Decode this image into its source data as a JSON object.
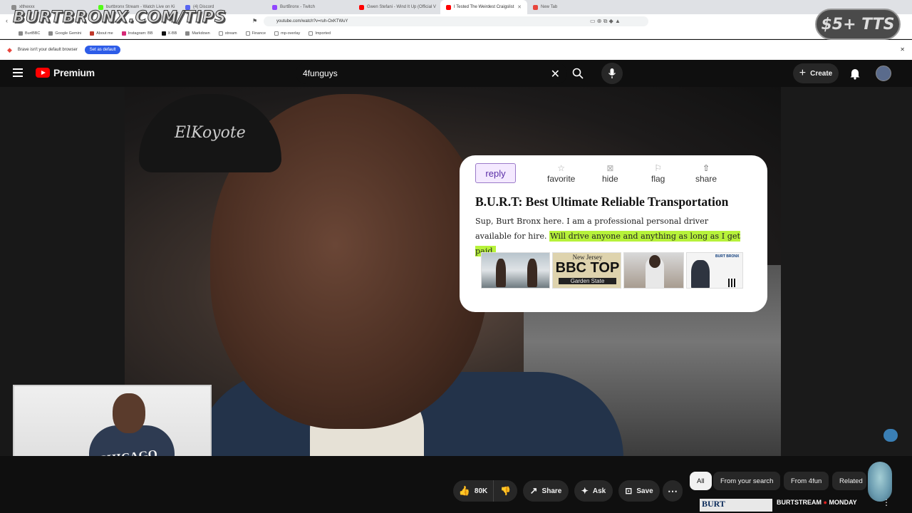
{
  "browser": {
    "tabs": [
      {
        "title": "xlthexxx",
        "fav_color": "#8c8c8c"
      },
      {
        "title": "burtbronx Stream - Watch Live on Ki",
        "fav_color": "#53fc18"
      },
      {
        "title": "(4) Discord",
        "fav_color": "#5865f2"
      },
      {
        "title": "BurtBronx - Twitch",
        "fav_color": "#9146ff"
      },
      {
        "title": "Gwen Stefani - Wind It Up (Official V",
        "fav_color": "#ff0000"
      },
      {
        "title": "I Tested The Weirdest Craigslist",
        "fav_color": "#ff0000",
        "active": true
      },
      {
        "title": "New Tab",
        "fav_color": "#e8453c"
      }
    ],
    "url": "youtube.com/watch?v=ruh-OxKTWuY",
    "bookmarks": [
      "BurtBBC",
      "Google Gemini",
      "About me",
      "Instagram: BB",
      "X-BB",
      "Markdown",
      "stream",
      "Finance",
      "mp-overlay",
      "Imported"
    ],
    "infobar_text": "Brave isn't your default browser",
    "infobar_button": "Set as default"
  },
  "overlay": {
    "brand": "BURTBRONX.COM/TIPS",
    "tts": "$5+ TTS"
  },
  "youtube": {
    "logo_text": "Premium",
    "search_value": "4funguys",
    "create_label": "Create"
  },
  "video": {
    "cap_text": "ElKoyote",
    "card": {
      "reply": "reply",
      "favorite": "favorite",
      "hide": "hide",
      "flag": "flag",
      "share": "share",
      "title": "B.U.R.T: Best Ultimate Reliable Transportation",
      "body_plain": "Sup, Burt Bronx here. I am a professional personal driver available for hire.",
      "body_highlight": "Will drive anyone and anything as long as I get paid.",
      "thumb2_top": "New Jersey",
      "thumb2_main": "BBC TOP",
      "thumb2_bottom": "Garden State",
      "thumb4_header": "BURT BRONX"
    }
  },
  "webcam": {
    "shirt_text": "CHICAGO"
  },
  "actions": {
    "likes": "80K",
    "share": "Share",
    "ask": "Ask",
    "save": "Save"
  },
  "chips": [
    "All",
    "From your search",
    "From 4fun",
    "Related"
  ],
  "related": {
    "thumb_text": "BURT",
    "channel_text": "BURTSTREAM",
    "day_text": "MONDAY"
  }
}
